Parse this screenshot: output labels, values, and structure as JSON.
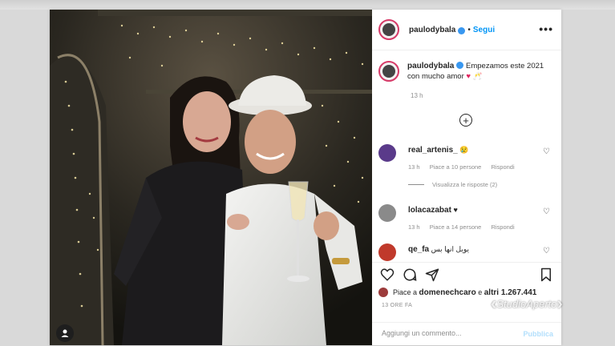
{
  "post": {
    "username": "paulodybala",
    "follow_label": "Segui",
    "separator": "•",
    "more_icon": "more-horizontal-icon"
  },
  "caption": {
    "username": "paulodybala",
    "text": "Empezamos este 2021 con mucho amor",
    "emoji": "♥ 🥂",
    "time": "13 h"
  },
  "comments": [
    {
      "username": "real_artenis_",
      "text": "😢",
      "time": "13 h",
      "likes": "Piace a 10 persone",
      "reply": "Rispondi",
      "view_replies": "Visualizza le risposte (2)",
      "avatar_color": "#5a3a8a"
    },
    {
      "username": "lolacazabat",
      "text": "♥",
      "time": "13 h",
      "likes": "Piace a 14 persone",
      "reply": "Rispondi",
      "avatar_color": "#8a8a8a"
    },
    {
      "username": "qe_fa",
      "text": "يويل انها بس",
      "avatar_color": "#c0392b"
    }
  ],
  "likes": {
    "prefix": "Piace a",
    "user": "domenechcaro",
    "middle": "e",
    "others": "altri 1.267.441"
  },
  "post_time": "13 ORE FA",
  "comment_box": {
    "placeholder": "Aggiungi un commento...",
    "publish_label": "Pubblica"
  },
  "watermark": {
    "text": "StudioAperto"
  },
  "colors": {
    "accent": "#0095f6",
    "verified": "#3897f0",
    "heart": "#e0245e"
  }
}
